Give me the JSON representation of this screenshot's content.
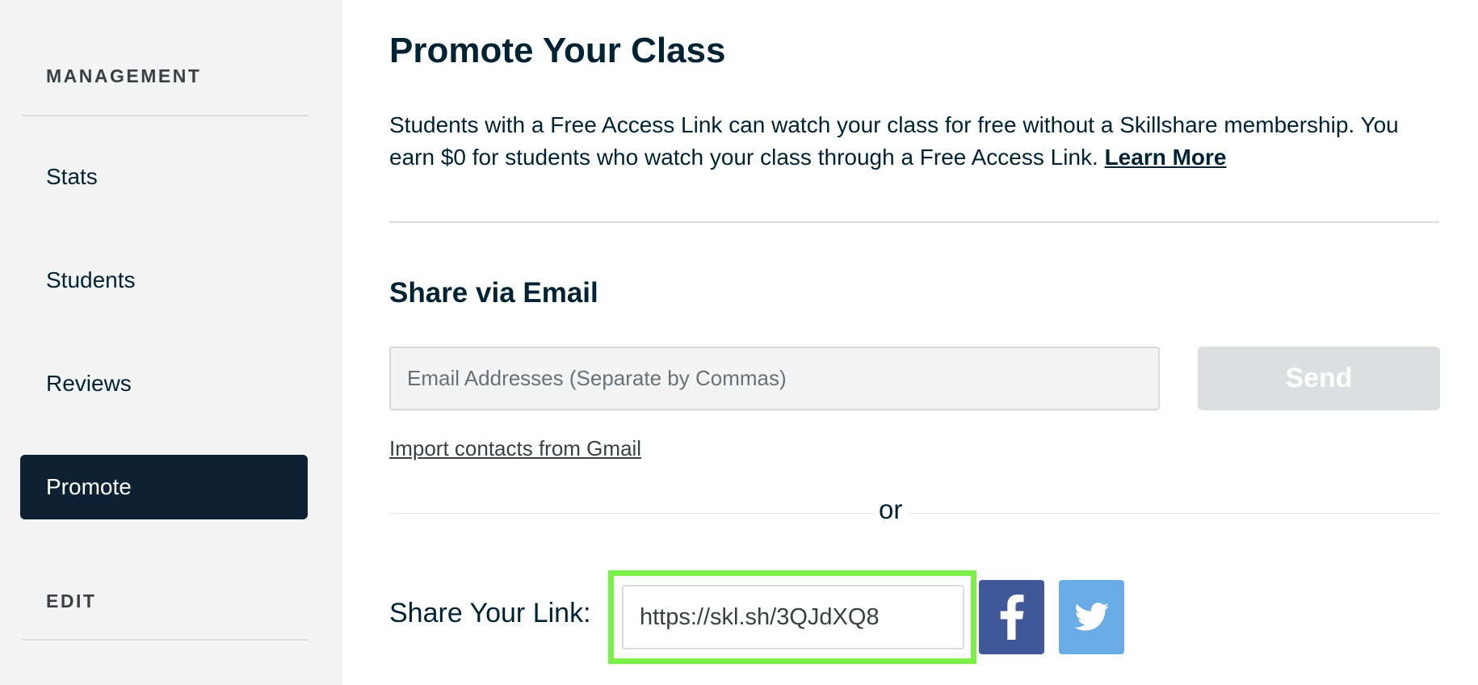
{
  "sidebar": {
    "management_label": "MANAGEMENT",
    "items": [
      {
        "label": "Stats"
      },
      {
        "label": "Students"
      },
      {
        "label": "Reviews"
      },
      {
        "label": "Promote",
        "active": true
      }
    ],
    "edit_label": "EDIT"
  },
  "main": {
    "title": "Promote Your Class",
    "intro_text": "Students with a Free Access Link can watch your class for free without a Skillshare membership. You earn $0 for students who watch your class through a Free Access Link.",
    "learn_more": "Learn More",
    "share_email_heading": "Share via Email",
    "email_placeholder": "Email Addresses (Separate by Commas)",
    "send_label": "Send",
    "import_label": "Import contacts from Gmail",
    "or_label": "or",
    "share_link_label": "Share Your Link:",
    "share_link_value": "https://skl.sh/3QJdXQ8",
    "icons": [
      "facebook-icon",
      "twitter-icon"
    ]
  },
  "colors": {
    "sidebar_active": "#0e2132",
    "highlight": "#7af049",
    "facebook": "#3f5998",
    "twitter": "#6aade6",
    "send_disabled": "#dddee0"
  }
}
